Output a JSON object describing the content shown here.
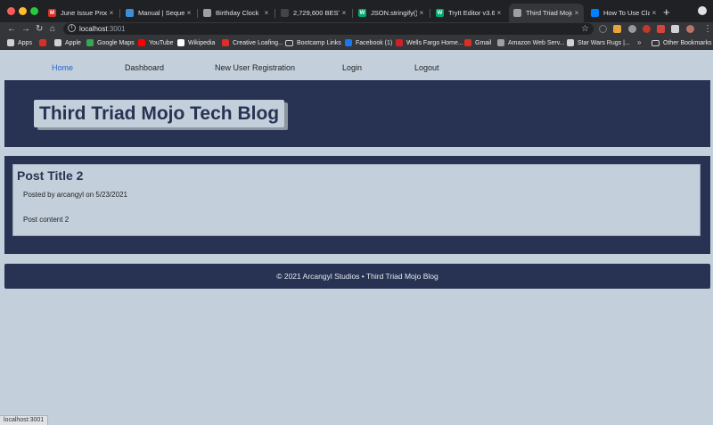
{
  "browser": {
    "tabs": [
      {
        "title": "June Issue Produc",
        "icon": "gmail-icon",
        "color": "#d93025",
        "glyph": "M"
      },
      {
        "title": "Manual | Sequelize",
        "icon": "sequelize-icon",
        "color": "#3b8fd6",
        "glyph": ""
      },
      {
        "title": "Birthday Clock",
        "icon": "globe-icon",
        "color": "#9aa0a6",
        "glyph": ""
      },
      {
        "title": "2,729,600 BEST E",
        "icon": "site-icon",
        "color": "#444",
        "glyph": ""
      },
      {
        "title": "JSON.stringify()",
        "icon": "w3schools-icon",
        "color": "#04aa6d",
        "glyph": "W"
      },
      {
        "title": "TryIt Editor v3.6",
        "icon": "w3schools-icon",
        "color": "#04aa6d",
        "glyph": "W"
      },
      {
        "title": "Third Triad Mojo T",
        "icon": "globe-icon",
        "color": "#9aa0a6",
        "glyph": ""
      },
      {
        "title": "How To Use Class",
        "icon": "digitalocean-icon",
        "color": "#0080ff",
        "glyph": ""
      }
    ],
    "active_tab": 6,
    "url_host": "localhost",
    "url_port": ":3001",
    "bookmarks": [
      {
        "label": "Apps",
        "icon": "apps-grid-icon",
        "color": "#cfd1d5"
      },
      {
        "label": "",
        "icon": "gmail-icon",
        "color": "#d93025"
      },
      {
        "label": "Apple",
        "icon": "apple-icon",
        "color": "#cfd1d5"
      },
      {
        "label": "Google Maps",
        "icon": "maps-icon",
        "color": "#34a853"
      },
      {
        "label": "YouTube",
        "icon": "youtube-icon",
        "color": "#ff0000"
      },
      {
        "label": "Wikipedia",
        "icon": "wikipedia-icon",
        "color": "#ffffff"
      },
      {
        "label": "Creative Loafing...",
        "icon": "gmail-icon",
        "color": "#d93025"
      },
      {
        "label": "Bootcamp Links",
        "icon": "folder-icon",
        "color": ""
      },
      {
        "label": "Facebook (1)",
        "icon": "facebook-icon",
        "color": "#1877f2"
      },
      {
        "label": "Wells Fargo Home...",
        "icon": "wellsfargo-icon",
        "color": "#d71e28"
      },
      {
        "label": "Gmail",
        "icon": "gmail-icon",
        "color": "#d93025"
      },
      {
        "label": "Amazon Web Serv...",
        "icon": "globe-icon",
        "color": "#9aa0a6"
      },
      {
        "label": "Star Wars Rugs |...",
        "icon": "star-icon",
        "color": "#cfd1d5"
      }
    ],
    "other_bookmarks": "Other Bookmarks",
    "status_url": "localhost:3001"
  },
  "nav": {
    "home": "Home",
    "dashboard": "Dashboard",
    "register": "New User Registration",
    "login": "Login",
    "logout": "Logout"
  },
  "site": {
    "title": "Third Triad Mojo Tech Blog"
  },
  "post": {
    "title": "Post Title 2",
    "meta": "Posted by arcangyl on 5/23/2021",
    "content": "Post content 2"
  },
  "footer": {
    "text": "© 2021 Arcangyl Studios • Third Triad Mojo Blog"
  }
}
